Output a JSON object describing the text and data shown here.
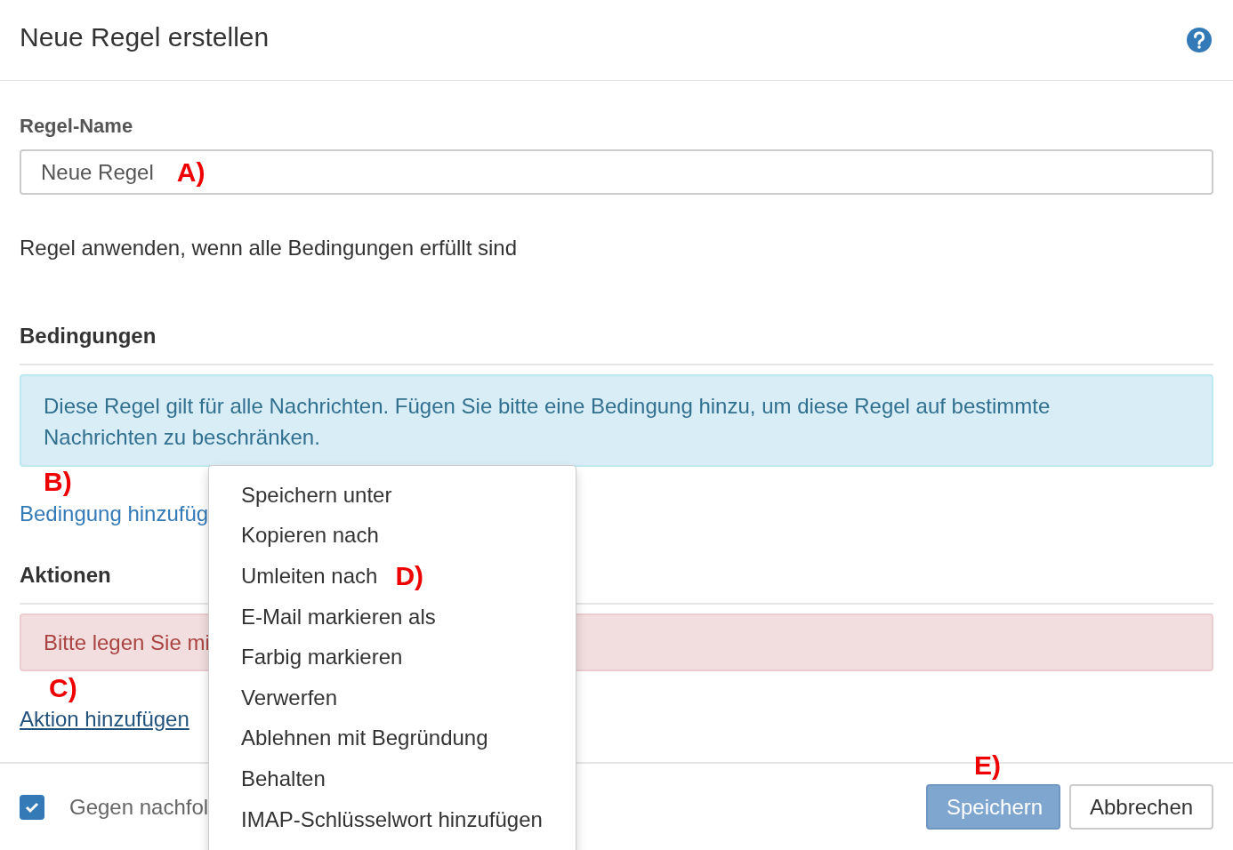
{
  "dialog": {
    "title": "Neue Regel erstellen"
  },
  "rule_name": {
    "label": "Regel-Name",
    "value": "Neue Regel",
    "annotation": "A)"
  },
  "apply_text": "Regel anwenden, wenn alle Bedingungen erfüllt sind",
  "conditions": {
    "heading": "Bedingungen",
    "info": "Diese Regel gilt für alle Nachrichten. Fügen Sie bitte eine Bedingung hinzu, um diese Regel auf bestimmte Nachrichten zu beschränken.",
    "annotation": "B)",
    "add_link": "Bedingung hinzufüg"
  },
  "actions": {
    "heading": "Aktionen",
    "error": "Bitte legen Sie mi",
    "annotation": "C)",
    "add_link": "Aktion hinzufügen"
  },
  "action_menu": {
    "items": [
      {
        "label": "Speichern unter"
      },
      {
        "label": "Kopieren nach"
      },
      {
        "label": "Umleiten nach",
        "annotation": "D)"
      },
      {
        "label": "E-Mail markieren als"
      },
      {
        "label": "Farbig markieren"
      },
      {
        "label": "Verwerfen"
      },
      {
        "label": "Ablehnen mit Begründung"
      },
      {
        "label": "Behalten"
      },
      {
        "label": "IMAP-Schlüsselwort hinzufügen"
      }
    ]
  },
  "footer": {
    "checkbox": {
      "label": "Gegen nachfol",
      "checked": true
    },
    "annotation": "E)",
    "buttons": [
      {
        "label": "Speichern",
        "kind": "primary",
        "disabled": true
      },
      {
        "label": "Abbrechen",
        "kind": "default",
        "disabled": false
      }
    ]
  }
}
